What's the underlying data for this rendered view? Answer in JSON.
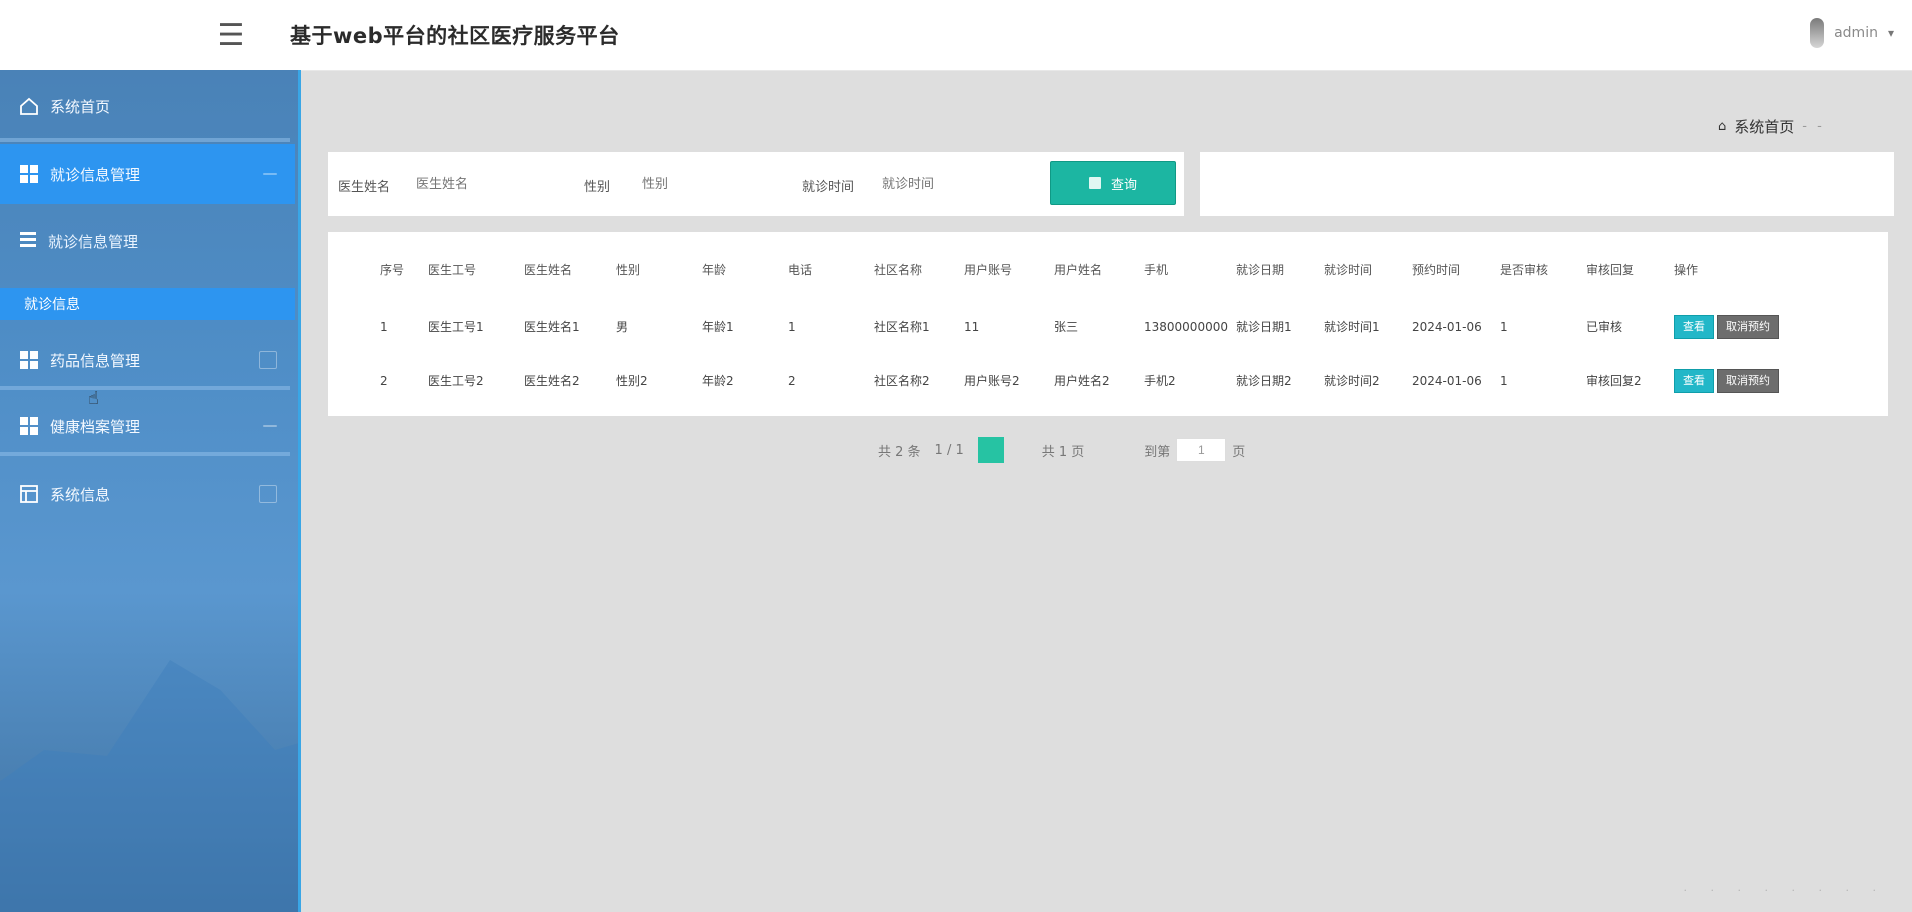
{
  "header": {
    "menu_icon": "menu-icon",
    "app_title": "基于web平台的社区医疗服务平台",
    "user_name": "admin",
    "caret_icon": "caret-down-icon"
  },
  "sidebar": {
    "home": "系统首页",
    "groups": [
      {
        "label": "就诊信息管理"
      },
      {
        "label": "就诊信息管理",
        "sub_group": "就诊信息管理"
      },
      {
        "label": "药品信息管理"
      },
      {
        "label": "健康档案管理"
      },
      {
        "label": "系统信息"
      }
    ],
    "active_sub": "就诊信息"
  },
  "breadcrumb": {
    "home": "系统首页",
    "rest": "- -"
  },
  "search": {
    "labels": [
      "医生姓名",
      "性别",
      "就诊时间"
    ],
    "placeholders": [
      "医生姓名",
      "性别",
      "就诊时间"
    ],
    "button": "查询"
  },
  "table": {
    "headers": [
      "序号",
      "医生工号",
      "医生姓名",
      "性别",
      "年龄",
      "电话",
      "社区名称",
      "用户账号",
      "用户姓名",
      "手机",
      "就诊日期",
      "就诊时间",
      "预约时间",
      "是否审核",
      "审核回复",
      "操作"
    ],
    "rows": [
      [
        "1",
        "医生工号1",
        "医生姓名1",
        "男",
        "年龄1",
        "1",
        "社区名称1",
        "11",
        "张三",
        "13800000000",
        "就诊日期1",
        "就诊时间1",
        "2024-01-06",
        "1",
        "已审核",
        ""
      ],
      [
        "2",
        "医生工号2",
        "医生姓名2",
        "性别2",
        "年龄2",
        "2",
        "社区名称2",
        "用户账号2",
        "用户姓名2",
        "手机2",
        "就诊日期2",
        "就诊时间2",
        "2024-01-06",
        "1",
        "审核回复2",
        ""
      ]
    ],
    "ops": {
      "view": "查看",
      "cancel": "取消预约"
    }
  },
  "pagination": {
    "prev_text": "共 2 条",
    "pages_text": "1 / 1",
    "total_text": "共 1 页",
    "goto_label": "到第",
    "goto_value": "1",
    "goto_suffix": "页"
  },
  "footer": {
    "text": ". . . . . . . ."
  }
}
